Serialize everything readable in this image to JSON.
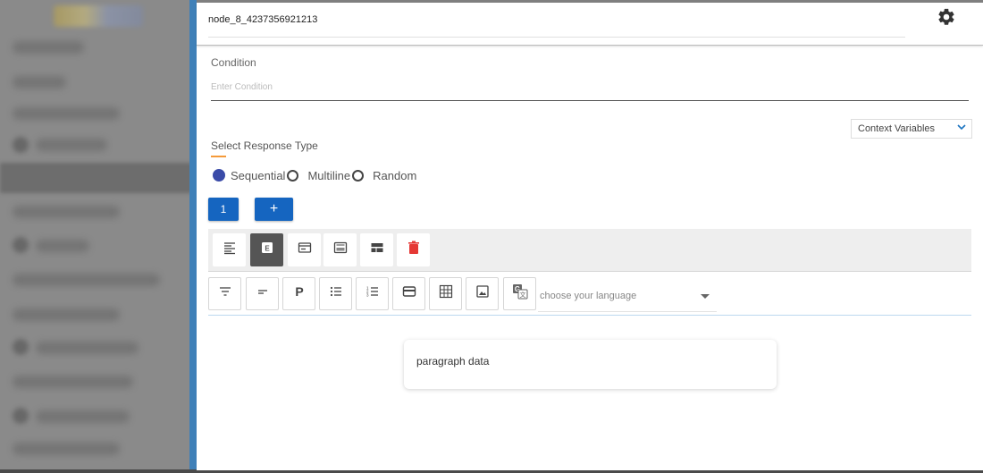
{
  "node": {
    "title": "node_8_4237356921213"
  },
  "condition": {
    "label": "Condition",
    "placeholder": "Enter Condition"
  },
  "context": {
    "label": "Context Variables"
  },
  "response_type": {
    "label": "Select Response Type",
    "options": [
      {
        "label": "Sequential",
        "selected": true
      },
      {
        "label": "Multiline",
        "selected": false
      },
      {
        "label": "Random",
        "selected": false
      }
    ]
  },
  "buttons": {
    "page_one": "1",
    "add": "+"
  },
  "toolbar_top": [
    "text-align-left-icon",
    "editor-icon",
    "card-icon",
    "carousel-icon",
    "template-icon",
    "delete-icon"
  ],
  "toolbar_bottom": [
    "filter-icon",
    "short-text-icon",
    "paragraph-icon",
    "bulleted-list-icon",
    "numbered-list-icon",
    "card-icon",
    "table-icon",
    "image-icon",
    "translate-icon"
  ],
  "language": {
    "placeholder": "choose your language"
  },
  "content": {
    "paragraph": "paragraph data"
  },
  "colors": {
    "accent": "#1565c0",
    "radio_selected": "#3a4ba8",
    "delete": "#e53935",
    "underline_accent": "#f59a3a"
  }
}
